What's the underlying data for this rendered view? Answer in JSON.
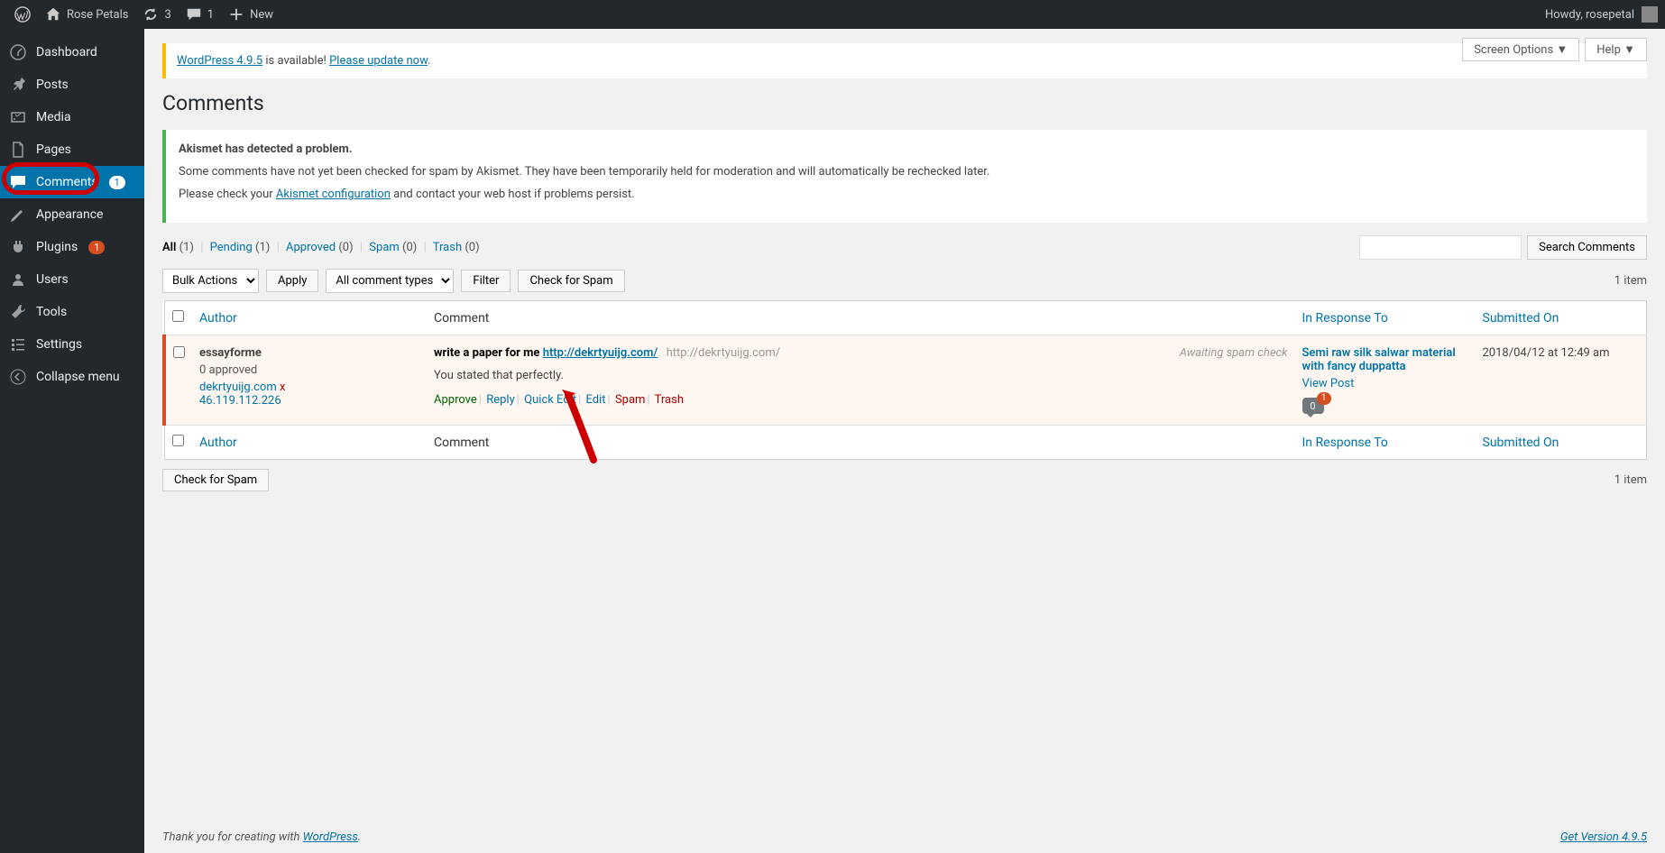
{
  "toolbar": {
    "site_name": "Rose Petals",
    "updates": "3",
    "comments": "1",
    "new_label": "New",
    "howdy": "Howdy, rosepetal"
  },
  "sidebar": {
    "items": [
      {
        "label": "Dashboard",
        "icon": "dashboard"
      },
      {
        "label": "Posts",
        "icon": "pin"
      },
      {
        "label": "Media",
        "icon": "media"
      },
      {
        "label": "Pages",
        "icon": "pages"
      },
      {
        "label": "Comments",
        "icon": "comment",
        "badge": "1",
        "active": true
      },
      {
        "label": "Appearance",
        "icon": "appearance"
      },
      {
        "label": "Plugins",
        "icon": "plugin",
        "badge": "1"
      },
      {
        "label": "Users",
        "icon": "users"
      },
      {
        "label": "Tools",
        "icon": "tools"
      },
      {
        "label": "Settings",
        "icon": "settings"
      },
      {
        "label": "Collapse menu",
        "icon": "collapse"
      }
    ]
  },
  "top_buttons": {
    "screen_options": "Screen Options",
    "help": "Help"
  },
  "update_notice": {
    "version_link": "WordPress 4.9.5",
    "text": " is available! ",
    "update_link": "Please update now"
  },
  "page_title": "Comments",
  "akismet": {
    "heading": "Akismet has detected a problem.",
    "line1": "Some comments have not yet been checked for spam by Akismet. They have been temporarily held for moderation and will automatically be rechecked later.",
    "line2_prefix": "Please check your ",
    "line2_link": "Akismet configuration",
    "line2_suffix": " and contact your web host if problems persist."
  },
  "filter_links": {
    "all": "All",
    "all_count": "(1)",
    "pending": "Pending",
    "pending_count": "(1)",
    "approved": "Approved",
    "approved_count": "(0)",
    "spam": "Spam",
    "spam_count": "(0)",
    "trash": "Trash",
    "trash_count": "(0)"
  },
  "search_button": "Search Comments",
  "tablenav": {
    "bulk_actions": "Bulk Actions",
    "apply": "Apply",
    "comment_types": "All comment types",
    "filter": "Filter",
    "check_spam": "Check for Spam",
    "items_count": "1 item"
  },
  "columns": {
    "author": "Author",
    "comment": "Comment",
    "response": "In Response To",
    "date": "Submitted On"
  },
  "row": {
    "author_name": "essayforme",
    "approved_text": "0 approved",
    "domain": "dekrtyuijg.com",
    "domain_x": " x",
    "ip": "46.119.112.226",
    "awaiting": "Awaiting spam check",
    "title_bold": "write a paper for me",
    "title_link": "http://dekrtyuijg.com/",
    "title_gray": "http://dekrtyuijg.com/",
    "body": "You stated that perfectly.",
    "actions": {
      "approve": "Approve",
      "reply": "Reply",
      "quickedit": "Quick Edit",
      "edit": "Edit",
      "spam": "Spam",
      "trash": "Trash"
    },
    "response_title": "Semi raw silk salwar material with fancy duppatta",
    "view_post": "View Post",
    "bubble_count": "0",
    "bubble_badge": "1",
    "date": "2018/04/12 at 12:49 am"
  },
  "footer": {
    "prefix": "Thank you for creating with ",
    "wp_link": "WordPress",
    "version_link": "Get Version 4.9.5"
  }
}
